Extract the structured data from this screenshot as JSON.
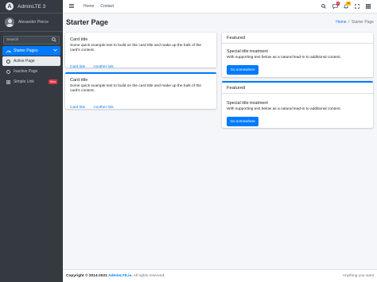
{
  "sidebar": {
    "brand_logo": "A",
    "brand": "AdminLTE 3",
    "user_name": "Alexander Pierce",
    "search_placeholder": "Search",
    "items": [
      {
        "label": "Starter Pages",
        "icon": "tachometer-icon",
        "state": "active-parent"
      },
      {
        "label": "Active Page",
        "icon": "circle-icon",
        "state": "active-child"
      },
      {
        "label": "Inactive Page",
        "icon": "circle-icon",
        "state": "normal"
      },
      {
        "label": "Simple Link",
        "icon": "th-icon",
        "state": "normal",
        "badge": "New"
      }
    ],
    "badge_color": "#dc3545"
  },
  "navbar": {
    "links": [
      "Home",
      "Contact"
    ],
    "messages_badge": "3",
    "notifications_badge": "15"
  },
  "header": {
    "title": "Starter Page",
    "breadcrumb": [
      "Home",
      "Starter Page"
    ]
  },
  "cards_left": [
    {
      "title": "Card title",
      "text": "Some quick example text to build on the card title and make up the bulk of the card's content.",
      "links": [
        "Card link",
        "Another link"
      ]
    },
    {
      "title": "Card title",
      "text": "Some quick example text to build on the card title and make up the bulk of the card's content.",
      "links": [
        "Card link",
        "Another link"
      ]
    }
  ],
  "cards_right": [
    {
      "header": "Featured",
      "title": "Special title treatment",
      "text": "With supporting text below as a natural lead-in to additional content.",
      "button": "Go somewhere"
    },
    {
      "header": "Featured",
      "title": "Special title treatment",
      "text": "With supporting text below as a natural lead-in to additional content.",
      "button": "Go somewhere"
    }
  ],
  "footer": {
    "copyright_prefix": "Copyright © 2014-2021",
    "link": "AdminLTE.io.",
    "suffix": "All rights reserved.",
    "right_text": "Anything you want"
  },
  "colors": {
    "primary": "#007bff",
    "sidebar_bg": "#343a40",
    "danger": "#dc3545",
    "warning": "#ffc107"
  }
}
